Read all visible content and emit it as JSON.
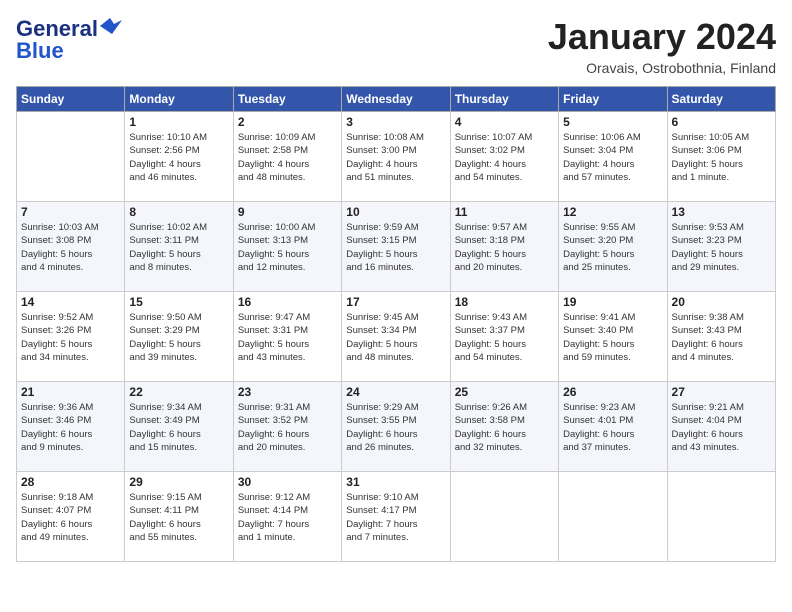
{
  "header": {
    "logo_line1": "General",
    "logo_line2": "Blue",
    "month_title": "January 2024",
    "location": "Oravais, Ostrobothnia, Finland"
  },
  "weekdays": [
    "Sunday",
    "Monday",
    "Tuesday",
    "Wednesday",
    "Thursday",
    "Friday",
    "Saturday"
  ],
  "weeks": [
    [
      {
        "day": "",
        "info": ""
      },
      {
        "day": "1",
        "info": "Sunrise: 10:10 AM\nSunset: 2:56 PM\nDaylight: 4 hours\nand 46 minutes."
      },
      {
        "day": "2",
        "info": "Sunrise: 10:09 AM\nSunset: 2:58 PM\nDaylight: 4 hours\nand 48 minutes."
      },
      {
        "day": "3",
        "info": "Sunrise: 10:08 AM\nSunset: 3:00 PM\nDaylight: 4 hours\nand 51 minutes."
      },
      {
        "day": "4",
        "info": "Sunrise: 10:07 AM\nSunset: 3:02 PM\nDaylight: 4 hours\nand 54 minutes."
      },
      {
        "day": "5",
        "info": "Sunrise: 10:06 AM\nSunset: 3:04 PM\nDaylight: 4 hours\nand 57 minutes."
      },
      {
        "day": "6",
        "info": "Sunrise: 10:05 AM\nSunset: 3:06 PM\nDaylight: 5 hours\nand 1 minute."
      }
    ],
    [
      {
        "day": "7",
        "info": "Sunrise: 10:03 AM\nSunset: 3:08 PM\nDaylight: 5 hours\nand 4 minutes."
      },
      {
        "day": "8",
        "info": "Sunrise: 10:02 AM\nSunset: 3:11 PM\nDaylight: 5 hours\nand 8 minutes."
      },
      {
        "day": "9",
        "info": "Sunrise: 10:00 AM\nSunset: 3:13 PM\nDaylight: 5 hours\nand 12 minutes."
      },
      {
        "day": "10",
        "info": "Sunrise: 9:59 AM\nSunset: 3:15 PM\nDaylight: 5 hours\nand 16 minutes."
      },
      {
        "day": "11",
        "info": "Sunrise: 9:57 AM\nSunset: 3:18 PM\nDaylight: 5 hours\nand 20 minutes."
      },
      {
        "day": "12",
        "info": "Sunrise: 9:55 AM\nSunset: 3:20 PM\nDaylight: 5 hours\nand 25 minutes."
      },
      {
        "day": "13",
        "info": "Sunrise: 9:53 AM\nSunset: 3:23 PM\nDaylight: 5 hours\nand 29 minutes."
      }
    ],
    [
      {
        "day": "14",
        "info": "Sunrise: 9:52 AM\nSunset: 3:26 PM\nDaylight: 5 hours\nand 34 minutes."
      },
      {
        "day": "15",
        "info": "Sunrise: 9:50 AM\nSunset: 3:29 PM\nDaylight: 5 hours\nand 39 minutes."
      },
      {
        "day": "16",
        "info": "Sunrise: 9:47 AM\nSunset: 3:31 PM\nDaylight: 5 hours\nand 43 minutes."
      },
      {
        "day": "17",
        "info": "Sunrise: 9:45 AM\nSunset: 3:34 PM\nDaylight: 5 hours\nand 48 minutes."
      },
      {
        "day": "18",
        "info": "Sunrise: 9:43 AM\nSunset: 3:37 PM\nDaylight: 5 hours\nand 54 minutes."
      },
      {
        "day": "19",
        "info": "Sunrise: 9:41 AM\nSunset: 3:40 PM\nDaylight: 5 hours\nand 59 minutes."
      },
      {
        "day": "20",
        "info": "Sunrise: 9:38 AM\nSunset: 3:43 PM\nDaylight: 6 hours\nand 4 minutes."
      }
    ],
    [
      {
        "day": "21",
        "info": "Sunrise: 9:36 AM\nSunset: 3:46 PM\nDaylight: 6 hours\nand 9 minutes."
      },
      {
        "day": "22",
        "info": "Sunrise: 9:34 AM\nSunset: 3:49 PM\nDaylight: 6 hours\nand 15 minutes."
      },
      {
        "day": "23",
        "info": "Sunrise: 9:31 AM\nSunset: 3:52 PM\nDaylight: 6 hours\nand 20 minutes."
      },
      {
        "day": "24",
        "info": "Sunrise: 9:29 AM\nSunset: 3:55 PM\nDaylight: 6 hours\nand 26 minutes."
      },
      {
        "day": "25",
        "info": "Sunrise: 9:26 AM\nSunset: 3:58 PM\nDaylight: 6 hours\nand 32 minutes."
      },
      {
        "day": "26",
        "info": "Sunrise: 9:23 AM\nSunset: 4:01 PM\nDaylight: 6 hours\nand 37 minutes."
      },
      {
        "day": "27",
        "info": "Sunrise: 9:21 AM\nSunset: 4:04 PM\nDaylight: 6 hours\nand 43 minutes."
      }
    ],
    [
      {
        "day": "28",
        "info": "Sunrise: 9:18 AM\nSunset: 4:07 PM\nDaylight: 6 hours\nand 49 minutes."
      },
      {
        "day": "29",
        "info": "Sunrise: 9:15 AM\nSunset: 4:11 PM\nDaylight: 6 hours\nand 55 minutes."
      },
      {
        "day": "30",
        "info": "Sunrise: 9:12 AM\nSunset: 4:14 PM\nDaylight: 7 hours\nand 1 minute."
      },
      {
        "day": "31",
        "info": "Sunrise: 9:10 AM\nSunset: 4:17 PM\nDaylight: 7 hours\nand 7 minutes."
      },
      {
        "day": "",
        "info": ""
      },
      {
        "day": "",
        "info": ""
      },
      {
        "day": "",
        "info": ""
      }
    ]
  ]
}
